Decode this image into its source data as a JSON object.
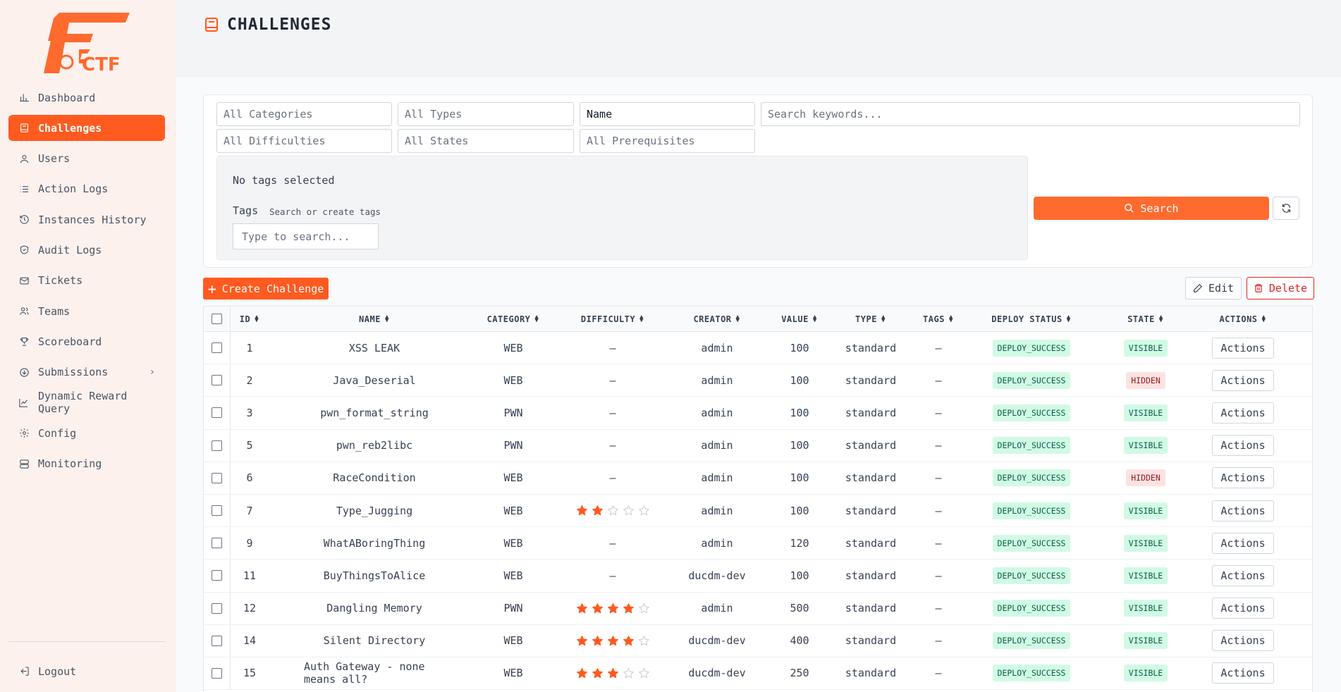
{
  "brand": {
    "logo_text": "FCTF",
    "accent": "#ff5a1f"
  },
  "sidebar": {
    "items": [
      {
        "label": "Dashboard",
        "icon": "bar-chart-icon",
        "active": false
      },
      {
        "label": "Challenges",
        "icon": "book-icon",
        "active": true
      },
      {
        "label": "Users",
        "icon": "user-icon",
        "active": false
      },
      {
        "label": "Action Logs",
        "icon": "list-icon",
        "active": false
      },
      {
        "label": "Instances History",
        "icon": "history-icon",
        "active": false
      },
      {
        "label": "Audit Logs",
        "icon": "shield-icon",
        "active": false
      },
      {
        "label": "Tickets",
        "icon": "mail-icon",
        "active": false
      },
      {
        "label": "Teams",
        "icon": "users-icon",
        "active": false
      },
      {
        "label": "Scoreboard",
        "icon": "trophy-icon",
        "active": false
      },
      {
        "label": "Submissions",
        "icon": "circle-arrow-icon",
        "active": false
      },
      {
        "label": "Dynamic Reward Query",
        "icon": "line-chart-icon",
        "active": false
      },
      {
        "label": "Config",
        "icon": "gear-icon",
        "active": false
      },
      {
        "label": "Monitoring",
        "icon": "server-icon",
        "active": false
      }
    ],
    "logout_label": "Logout"
  },
  "header": {
    "title": "CHALLENGES"
  },
  "filters": {
    "category": "All Categories",
    "type": "All Types",
    "search_field": "Name",
    "keywords_placeholder": "Search keywords...",
    "difficulty": "All Difficulties",
    "state": "All States",
    "prerequisites": "All Prerequisites",
    "no_tags": "No tags selected",
    "tags_label": "Tags",
    "tags_hint": "Search or create tags",
    "tags_placeholder": "Type to search...",
    "search_label": "Search"
  },
  "toolbar": {
    "create_label": "Create Challenge",
    "edit_label": "Edit",
    "delete_label": "Delete"
  },
  "table": {
    "columns": [
      "ID",
      "NAME",
      "CATEGORY",
      "DIFFICULTY",
      "CREATOR",
      "VALUE",
      "TYPE",
      "TAGS",
      "DEPLOY STATUS",
      "STATE",
      "ACTIONS"
    ],
    "rows": [
      {
        "id": "1",
        "name": "XSS LEAK",
        "category": "WEB",
        "difficulty": 0,
        "creator": "admin",
        "value": "100",
        "type": "standard",
        "tags": "—",
        "deploy": "DEPLOY_SUCCESS",
        "state": "VISIBLE",
        "action": "Actions"
      },
      {
        "id": "2",
        "name": "Java_Deserial",
        "category": "WEB",
        "difficulty": 0,
        "creator": "admin",
        "value": "100",
        "type": "standard",
        "tags": "—",
        "deploy": "DEPLOY_SUCCESS",
        "state": "HIDDEN",
        "action": "Actions"
      },
      {
        "id": "3",
        "name": "pwn_format_string",
        "category": "PWN",
        "difficulty": 0,
        "creator": "admin",
        "value": "100",
        "type": "standard",
        "tags": "—",
        "deploy": "DEPLOY_SUCCESS",
        "state": "VISIBLE",
        "action": "Actions"
      },
      {
        "id": "5",
        "name": "pwn_reb2libc",
        "category": "PWN",
        "difficulty": 0,
        "creator": "admin",
        "value": "100",
        "type": "standard",
        "tags": "—",
        "deploy": "DEPLOY_SUCCESS",
        "state": "VISIBLE",
        "action": "Actions"
      },
      {
        "id": "6",
        "name": "RaceCondition",
        "category": "WEB",
        "difficulty": 0,
        "creator": "admin",
        "value": "100",
        "type": "standard",
        "tags": "—",
        "deploy": "DEPLOY_SUCCESS",
        "state": "HIDDEN",
        "action": "Actions"
      },
      {
        "id": "7",
        "name": "Type_Jugging",
        "category": "WEB",
        "difficulty": 2,
        "creator": "admin",
        "value": "100",
        "type": "standard",
        "tags": "—",
        "deploy": "DEPLOY_SUCCESS",
        "state": "VISIBLE",
        "action": "Actions"
      },
      {
        "id": "9",
        "name": "WhatABoringThing",
        "category": "WEB",
        "difficulty": 0,
        "creator": "admin",
        "value": "120",
        "type": "standard",
        "tags": "—",
        "deploy": "DEPLOY_SUCCESS",
        "state": "VISIBLE",
        "action": "Actions"
      },
      {
        "id": "11",
        "name": "BuyThingsToAlice",
        "category": "WEB",
        "difficulty": 0,
        "creator": "ducdm-dev",
        "value": "100",
        "type": "standard",
        "tags": "—",
        "deploy": "DEPLOY_SUCCESS",
        "state": "VISIBLE",
        "action": "Actions"
      },
      {
        "id": "12",
        "name": "Dangling Memory",
        "category": "PWN",
        "difficulty": 4,
        "creator": "admin",
        "value": "500",
        "type": "standard",
        "tags": "—",
        "deploy": "DEPLOY_SUCCESS",
        "state": "VISIBLE",
        "action": "Actions"
      },
      {
        "id": "14",
        "name": "Silent Directory",
        "category": "WEB",
        "difficulty": 4,
        "creator": "ducdm-dev",
        "value": "400",
        "type": "standard",
        "tags": "—",
        "deploy": "DEPLOY_SUCCESS",
        "state": "VISIBLE",
        "action": "Actions"
      },
      {
        "id": "15",
        "name": "Auth Gateway - none means all?",
        "category": "WEB",
        "difficulty": 3,
        "creator": "ducdm-dev",
        "value": "250",
        "type": "standard",
        "tags": "—",
        "deploy": "DEPLOY_SUCCESS",
        "state": "VISIBLE",
        "action": "Actions"
      }
    ],
    "empty_difficulty": "—",
    "max_stars": 5
  }
}
